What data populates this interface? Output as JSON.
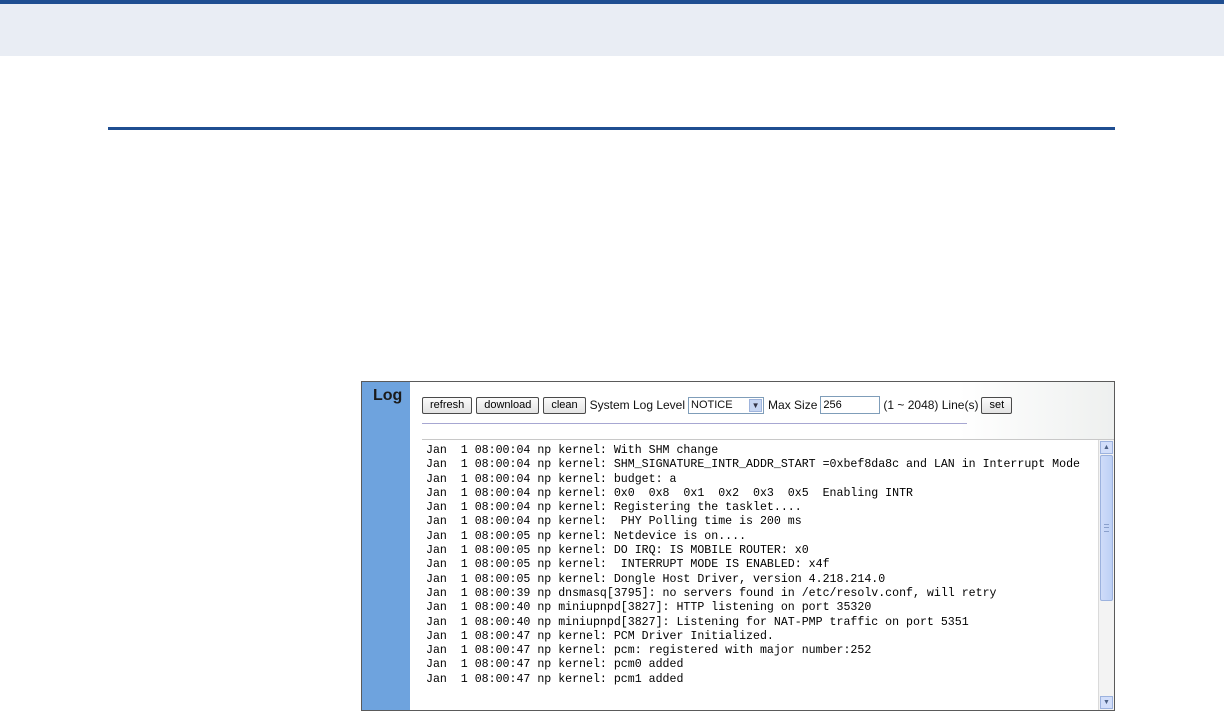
{
  "log_panel": {
    "tab_label": "Log",
    "toolbar": {
      "refresh_label": "refresh",
      "download_label": "download",
      "clean_label": "clean",
      "level_label": "System Log Level",
      "level_value": "NOTICE",
      "max_size_label": "Max Size",
      "max_size_value": "256",
      "range_label": "(1 ~ 2048) Line(s)",
      "set_label": "set"
    },
    "lines": [
      "Jan  1 08:00:04 np kernel: With SHM change",
      "Jan  1 08:00:04 np kernel: SHM_SIGNATURE_INTR_ADDR_START =0xbef8da8c and LAN in Interrupt Mode",
      "Jan  1 08:00:04 np kernel: budget: a",
      "Jan  1 08:00:04 np kernel: 0x0  0x8  0x1  0x2  0x3  0x5  Enabling INTR",
      "Jan  1 08:00:04 np kernel: Registering the tasklet....",
      "Jan  1 08:00:04 np kernel:  PHY Polling time is 200 ms",
      "Jan  1 08:00:05 np kernel: Netdevice is on....",
      "Jan  1 08:00:05 np kernel: DO IRQ: IS MOBILE ROUTER: x0",
      "Jan  1 08:00:05 np kernel:  INTERRUPT MODE IS ENABLED: x4f",
      "Jan  1 08:00:05 np kernel: Dongle Host Driver, version 4.218.214.0",
      "Jan  1 08:00:39 np dnsmasq[3795]: no servers found in /etc/resolv.conf, will retry",
      "Jan  1 08:00:40 np miniupnpd[3827]: HTTP listening on port 35320",
      "Jan  1 08:00:40 np miniupnpd[3827]: Listening for NAT-PMP traffic on port 5351",
      "Jan  1 08:00:47 np kernel: PCM Driver Initialized.",
      "Jan  1 08:00:47 np kernel: pcm: registered with major number:252",
      "Jan  1 08:00:47 np kernel: pcm0 added",
      "Jan  1 08:00:47 np kernel: pcm1 added"
    ]
  },
  "icons": {
    "scroll_up": "scroll-up-arrow-icon",
    "scroll_down": "scroll-down-arrow-icon",
    "dropdown": "chevron-down-icon"
  },
  "colors": {
    "accent": "#1f4e91",
    "side_tab": "#6ea3de",
    "top_band": "#e9edf4"
  }
}
